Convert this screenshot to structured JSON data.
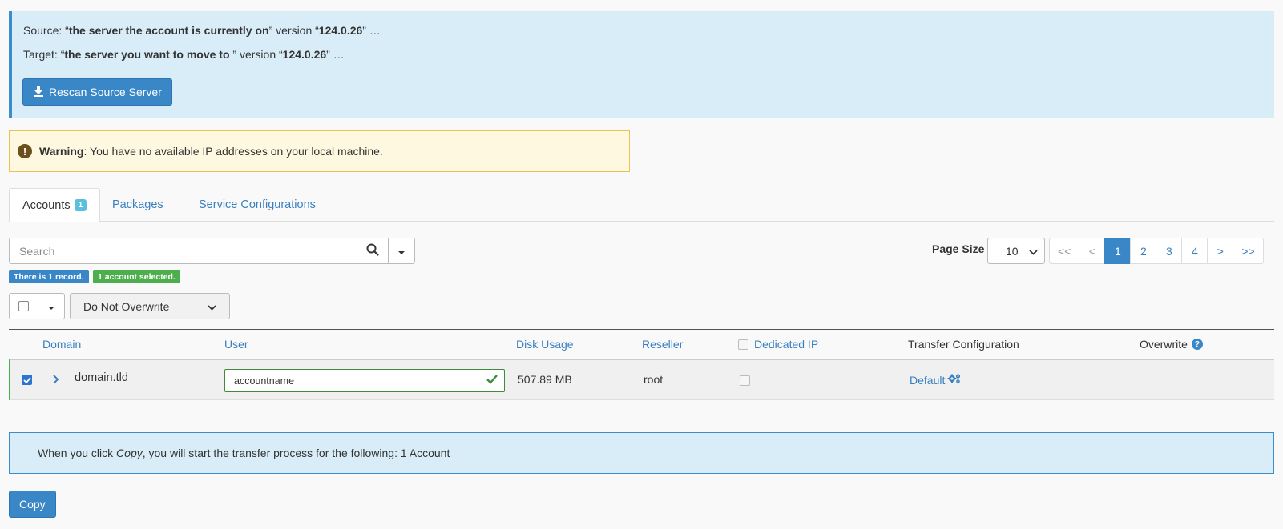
{
  "source_panel": {
    "source_prefix": "Source: “",
    "source_name": "the server the account is currently on",
    "source_mid": "” version “",
    "source_version": "124.0.26",
    "source_suffix": "” …",
    "target_prefix": "Target: “",
    "target_name": "the server you want to move to ",
    "target_mid": "” version “",
    "target_version": "124.0.26",
    "target_suffix": "” …",
    "rescan_label": "Rescan Source Server"
  },
  "warning": {
    "title": "Warning",
    "message": ": You have no available IP addresses on your local machine."
  },
  "tabs": [
    {
      "label": "Accounts",
      "badge": "1",
      "active": true
    },
    {
      "label": "Packages"
    },
    {
      "label": "Service Configurations"
    }
  ],
  "search": {
    "placeholder": "Search"
  },
  "badges": {
    "records": "There is 1 record.",
    "selected": "1 account selected."
  },
  "bulk": {
    "overwrite_option": "Do Not Overwrite"
  },
  "pagination": {
    "page_size_label": "Page Size",
    "page_size": "10",
    "first": "<<",
    "prev": "<",
    "pages": [
      "1",
      "2",
      "3",
      "4"
    ],
    "next": ">",
    "last": ">>",
    "current_page": "1"
  },
  "table": {
    "headers": {
      "domain": "Domain",
      "user": "User",
      "disk_usage": "Disk Usage",
      "reseller": "Reseller",
      "dedicated_ip": "Dedicated IP",
      "transfer_configuration": "Transfer Configuration",
      "overwrite": "Overwrite"
    },
    "rows": [
      {
        "domain": "domain.tld",
        "user": "accountname",
        "disk_usage": "507.89 MB",
        "reseller": "root",
        "transfer_configuration": "Default"
      }
    ]
  },
  "copy_info": {
    "prefix": "When you click ",
    "emph": "Copy",
    "suffix": ", you will start the transfer process for the following: 1 Account"
  },
  "copy_button": "Copy",
  "colors": {
    "accent": "#3a87c8",
    "info_bg": "#d9edf8",
    "warning_bg": "#fff8e1",
    "success": "#4cae4c"
  }
}
